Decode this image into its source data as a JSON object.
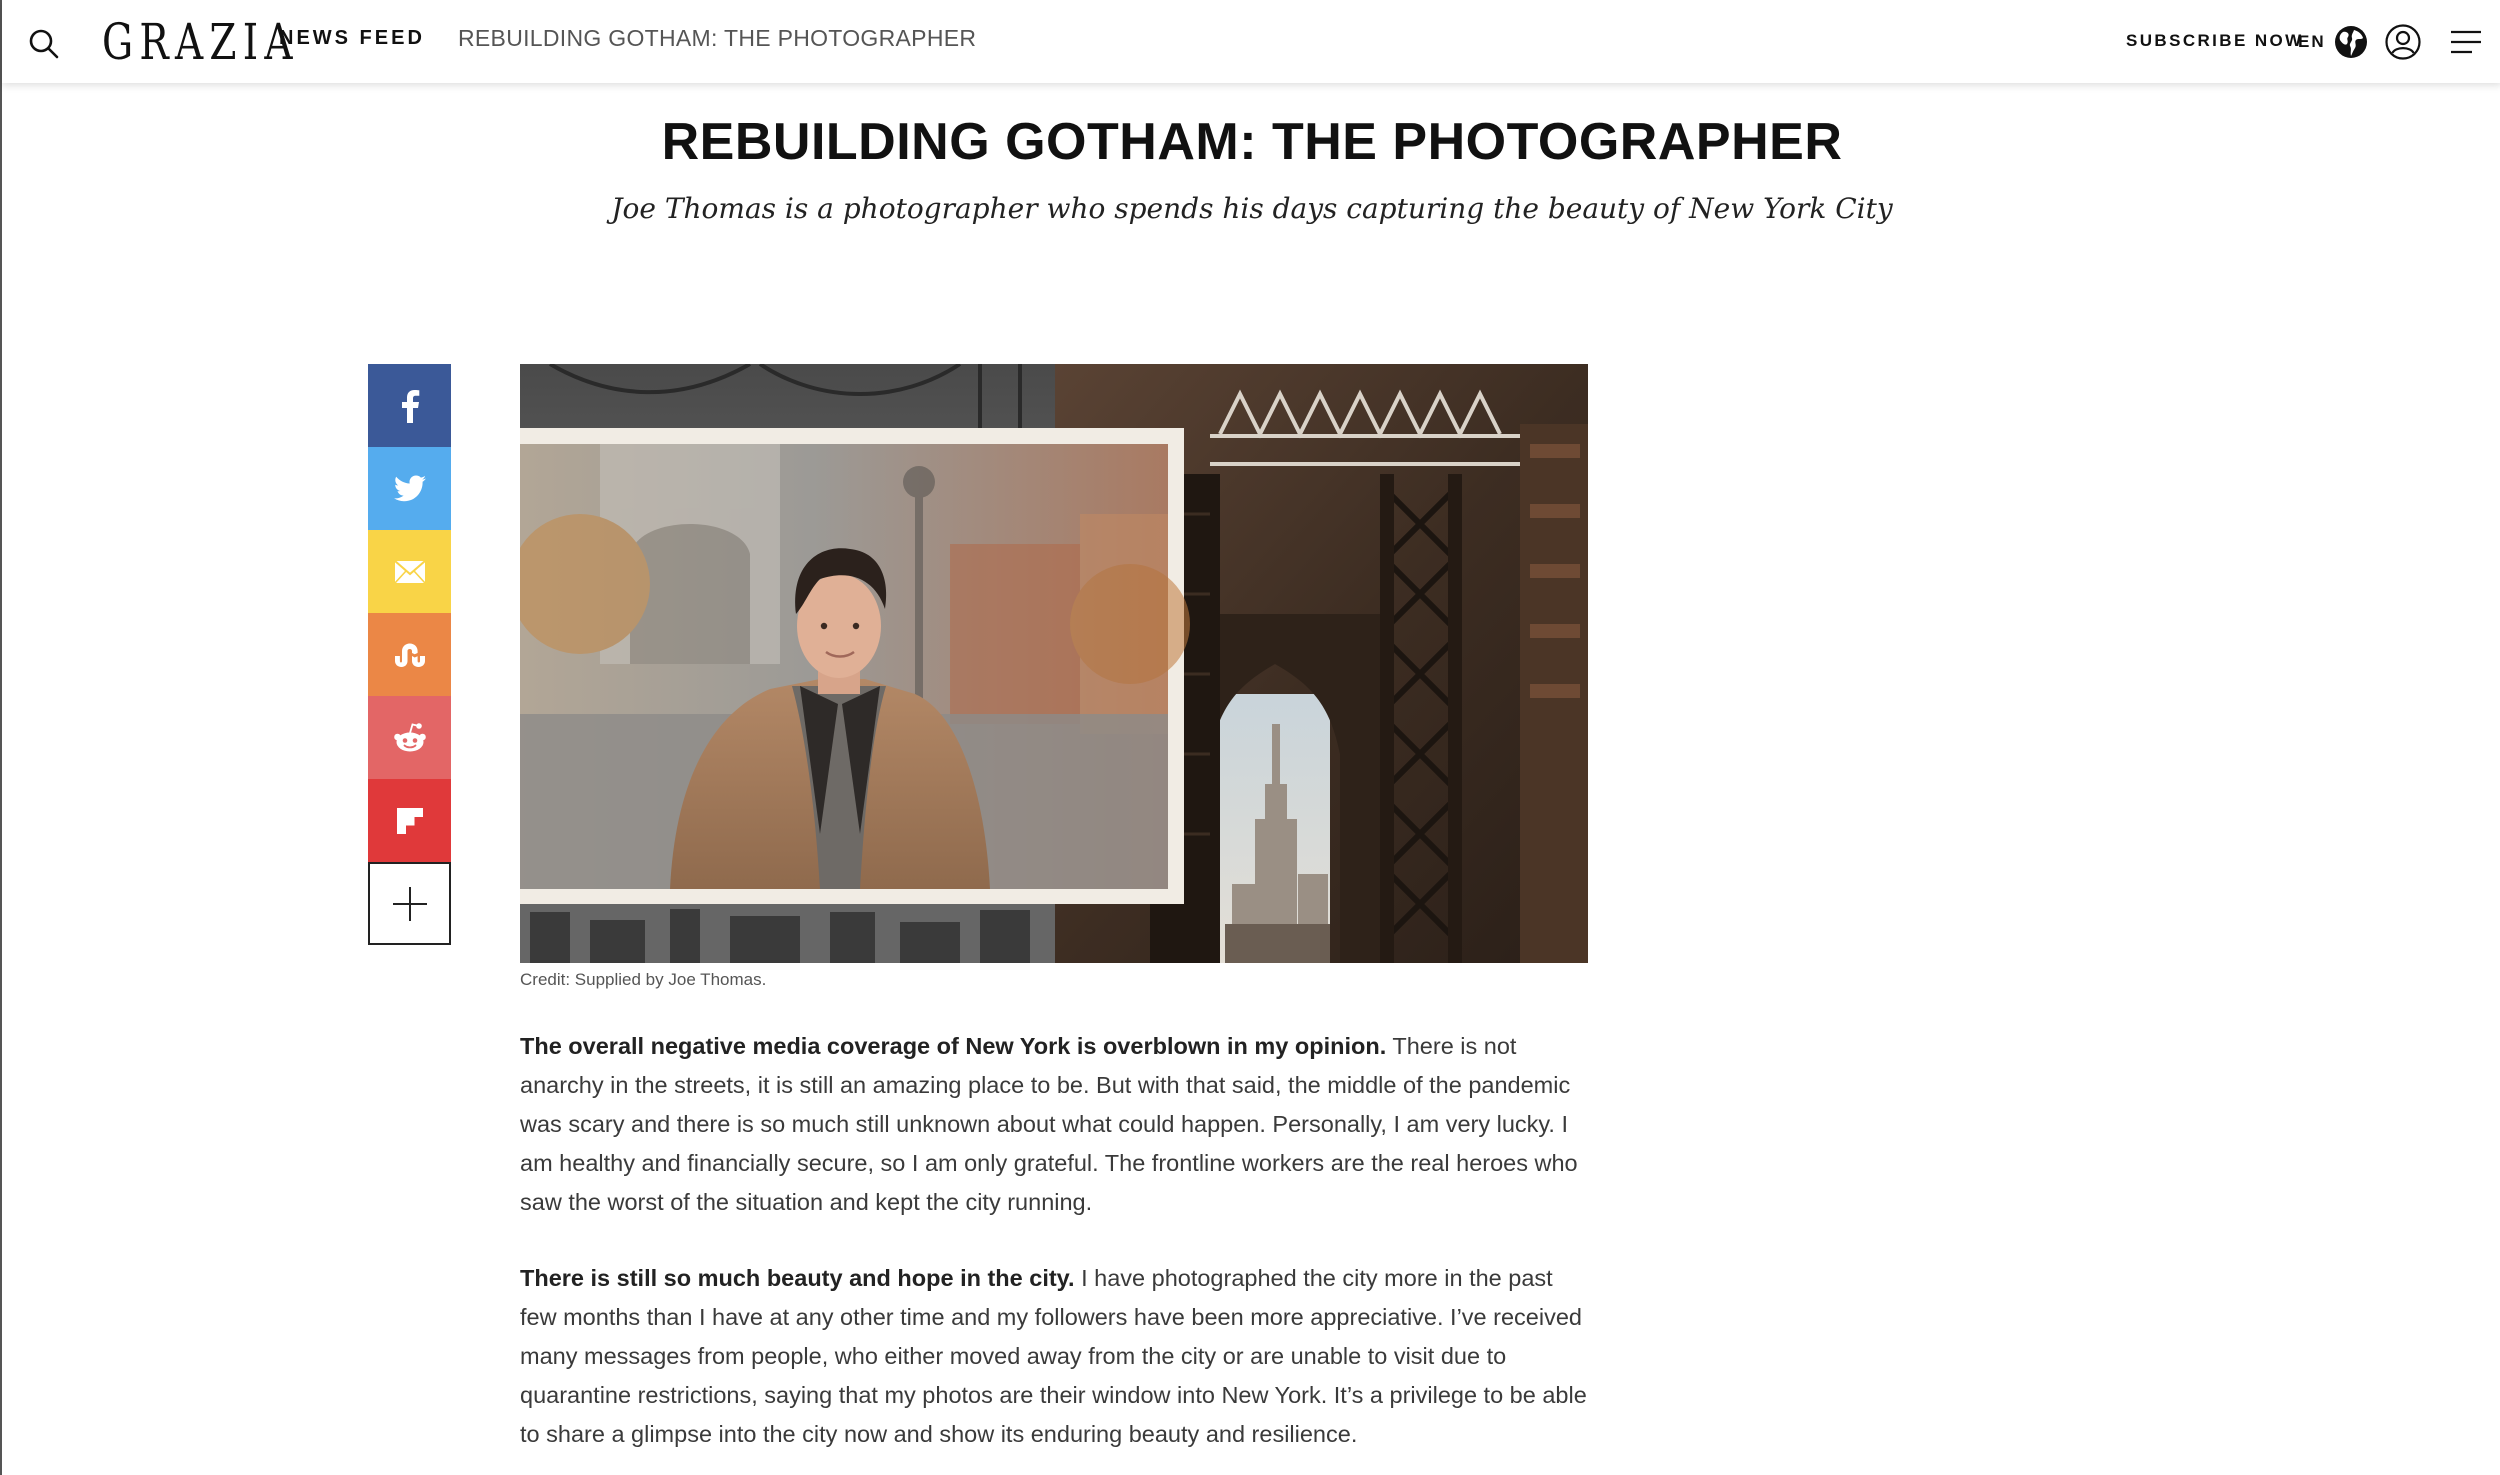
{
  "header": {
    "logo": "GRAZIA",
    "news_feed": "NEWS FEED",
    "current_article": "REBUILDING GOTHAM: THE PHOTOGRAPHER",
    "subscribe": "SUBSCRIBE NOW",
    "language": "EN",
    "icons": [
      "search-icon",
      "globe-icon",
      "account-icon",
      "hamburger-menu-icon"
    ]
  },
  "article": {
    "title": "REBUILDING GOTHAM: THE PHOTOGRAPHER",
    "standfirst": "Joe Thomas is a photographer who spends his days capturing the beauty of New York City",
    "image_credit": "Credit: Supplied by Joe Thomas.",
    "paragraphs": [
      {
        "lead": "The overall negative media coverage of New York is overblown in my opinion.",
        "text": " There is not anarchy in the streets, it is still an amazing place to be. But with that said, the middle of the pandemic was scary and there is so much still unknown about what could happen. Personally, I am very lucky. I am healthy and financially secure, so I am only grateful. The frontline workers are the real heroes who saw the worst of the situation and kept the city running."
      },
      {
        "lead": "There is still so much beauty and hope in the city.",
        "text": " I have photographed the city more in the past few months than I have at any other time and my followers have been more appreciative. I’ve received many messages from people, who either moved away from the city or are unable to visit due to quarantine restrictions, saying that my photos are their window into New York. It’s a privilege to be able to share a glimpse into the city now and show its enduring beauty and resilience."
      }
    ]
  },
  "share": {
    "buttons": [
      {
        "icon": "facebook-icon",
        "color": "#3b5998"
      },
      {
        "icon": "twitter-icon",
        "color": "#55acee"
      },
      {
        "icon": "email-icon",
        "color": "#f9d447"
      },
      {
        "icon": "stumbleupon-icon",
        "color": "#eb8746"
      },
      {
        "icon": "reddit-icon",
        "color": "#e36666"
      },
      {
        "icon": "flipboard-icon",
        "color": "#e0393a"
      },
      {
        "icon": "plus-icon",
        "color": "#ffffff"
      }
    ]
  }
}
